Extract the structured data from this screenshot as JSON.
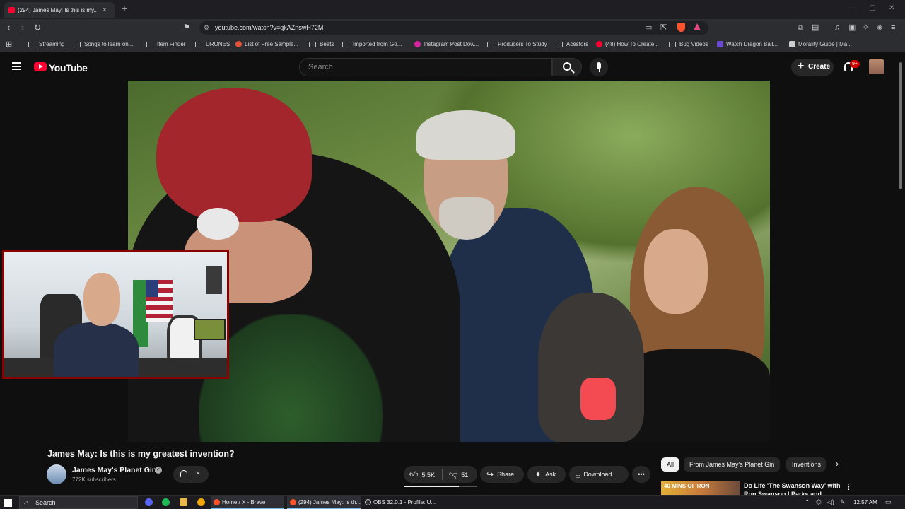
{
  "browser": {
    "tab_title": "(294) James May: Is this is my...",
    "url": "youtube.com/watch?v=qkAZnswH72M",
    "bookmarks": [
      "Streaming",
      "Songs to learn on...",
      "Item Finder",
      "DRONES",
      "List of Free Sample...",
      "Beats",
      "Imported from Go...",
      "Instagram Post Dow...",
      "Producers To Study",
      "Acestors",
      "(48) How To Create...",
      "Bug Videos",
      "Watch Dragon Ball...",
      "Morality Guide | Ma..."
    ]
  },
  "youtube": {
    "logo_text": "YouTube",
    "search_placeholder": "Search",
    "create_label": "Create",
    "notification_count": "9+"
  },
  "video": {
    "title": "James May: Is this is my greatest invention?",
    "channel": "James May's Planet Gin",
    "subscribers": "772K subscribers",
    "likes": "5.5K",
    "dislikes": "51",
    "like_ratio": 0.75,
    "share_label": "Share",
    "ask_label": "Ask",
    "download_label": "Download"
  },
  "sidebar": {
    "chips": [
      "All",
      "From James May's Planet Gin",
      "Inventions"
    ],
    "recommendation": {
      "thumb_text": "40 MINS OF RON",
      "title": "Do Life 'The Swanson Way' with Ron Swanson | Parks and..."
    }
  },
  "taskbar": {
    "search": "Search",
    "apps": [
      "Home / X - Brave",
      "(294) James May: Is th...",
      "OBS 32.0.1 - Profile: U..."
    ],
    "clock": "12:57 AM"
  },
  "colors": {
    "accent_red": "#ff0033",
    "background": "#0f0f0f",
    "webcam_border": "#8b0000"
  }
}
